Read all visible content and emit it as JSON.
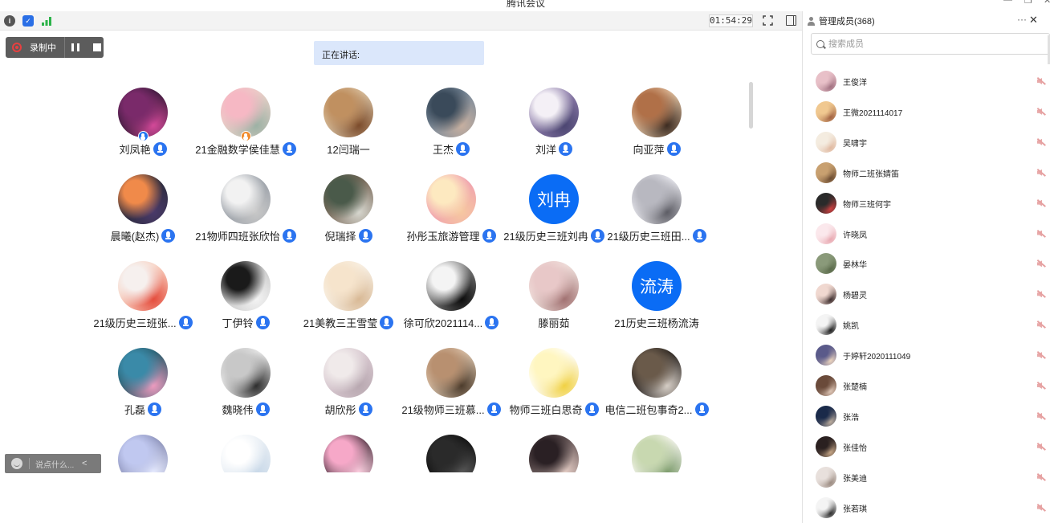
{
  "window": {
    "title": "腾讯会议"
  },
  "toolbar": {
    "timer": "01:54:29"
  },
  "recording": {
    "label": "录制中"
  },
  "speaking": {
    "label": "正在讲话:"
  },
  "chat": {
    "placeholder": "说点什么...",
    "chevron": "<"
  },
  "colors": {
    "accent": "#0a6cf5",
    "speaking_bg": "#dbe7fb",
    "rec_bar": "#5c5c5c"
  },
  "participants": [
    {
      "name": "刘凤艳",
      "avatar": "photo",
      "colors": [
        "#7a2a6a",
        "#d64a9a",
        "#3a1a3a"
      ],
      "mic": true,
      "badge": "host"
    },
    {
      "name": "21金融数学侯佳慧",
      "avatar": "photo",
      "colors": [
        "#f6b8c4",
        "#9bb1a4",
        "#e8d0c8"
      ],
      "mic": true,
      "badge": "cohost"
    },
    {
      "name": "12闫瑞一",
      "avatar": "photo",
      "colors": [
        "#c09060",
        "#7a4a2a",
        "#d8c0a0"
      ],
      "mic": false
    },
    {
      "name": "王杰",
      "avatar": "photo",
      "colors": [
        "#3a4a5a",
        "#c8b0a0",
        "#7a8a9a"
      ],
      "mic": true
    },
    {
      "name": "刘洋",
      "avatar": "photo",
      "colors": [
        "#f4f0f6",
        "#4a4470",
        "#8a7aa8"
      ],
      "mic": true
    },
    {
      "name": "向亚萍",
      "avatar": "photo",
      "colors": [
        "#b07048",
        "#3a2a20",
        "#e0c0a0"
      ],
      "mic": true
    },
    {
      "name": "晨曦(赵杰)",
      "avatar": "photo",
      "colors": [
        "#f08a4a",
        "#4a3a6a",
        "#2a2a3a"
      ],
      "mic": true
    },
    {
      "name": "21物师四班张欣怡",
      "avatar": "photo",
      "colors": [
        "#f2f2f2",
        "#c8c8c8",
        "#9aa0a8"
      ],
      "mic": true
    },
    {
      "name": "倪瑞择",
      "avatar": "photo",
      "colors": [
        "#4a5a4a",
        "#d8d8d0",
        "#7a6a5a"
      ],
      "mic": true
    },
    {
      "name": "孙彤玉旅游管理",
      "avatar": "photo",
      "colors": [
        "#fde9c0",
        "#f6c8a0",
        "#f0a0b0"
      ],
      "mic": true
    },
    {
      "name": "21级历史三班刘冉",
      "avatar": "text",
      "text": "刘冉",
      "mic": true
    },
    {
      "name": "21级历史三班田...",
      "avatar": "photo",
      "colors": [
        "#b8b8c0",
        "#5a5a62",
        "#e8e8ee"
      ],
      "mic": true
    },
    {
      "name": "21级历史三班张...",
      "avatar": "photo",
      "colors": [
        "#f6f0ee",
        "#e44a3a",
        "#f8d0c0"
      ],
      "mic": true
    },
    {
      "name": "丁伊铃",
      "avatar": "photo",
      "colors": [
        "#1a1a1a",
        "#f4f4f4",
        "#c8c8c8"
      ],
      "mic": true
    },
    {
      "name": "21美教三王雪莹",
      "avatar": "photo",
      "colors": [
        "#f6e4cc",
        "#d8b894",
        "#f8f0e4"
      ],
      "mic": true
    },
    {
      "name": "徐可欣2021114...",
      "avatar": "photo",
      "colors": [
        "#f4f4f4",
        "#0a0a0a",
        "#7a7a7a"
      ],
      "mic": true
    },
    {
      "name": "滕丽茹",
      "avatar": "photo",
      "colors": [
        "#e8c8c8",
        "#a07070",
        "#f0e0dc"
      ],
      "mic": false
    },
    {
      "name": "21历史三班杨流涛",
      "avatar": "text",
      "text": "流涛",
      "mic": false
    },
    {
      "name": "孔磊",
      "avatar": "photo",
      "colors": [
        "#3a8aa8",
        "#f09cc0",
        "#2a5a6a"
      ],
      "mic": true
    },
    {
      "name": "魏晓伟",
      "avatar": "photo",
      "colors": [
        "#c8c8c8",
        "#2a2a2a",
        "#e8e8e8"
      ],
      "mic": true
    },
    {
      "name": "胡欣彤",
      "avatar": "photo",
      "colors": [
        "#f0eaea",
        "#b8a8b0",
        "#d8c8d0"
      ],
      "mic": true
    },
    {
      "name": "21级物师三班慕...",
      "avatar": "photo",
      "colors": [
        "#b89070",
        "#4a3a2a",
        "#d8c0a8"
      ],
      "mic": true
    },
    {
      "name": "物师三班白思奇",
      "avatar": "photo",
      "colors": [
        "#fff6c0",
        "#f0d040",
        "#ffffff"
      ],
      "mic": true
    },
    {
      "name": "电信二班包事奇2...",
      "avatar": "photo",
      "colors": [
        "#6a5a4a",
        "#d8d0c8",
        "#2a2420"
      ],
      "mic": true
    },
    {
      "name": "",
      "avatar": "photo",
      "colors": [
        "#c0c8f0",
        "#e8ecff",
        "#8a90b8"
      ],
      "mic": false
    },
    {
      "name": "",
      "avatar": "photo",
      "colors": [
        "#ffffff",
        "#c8d8e8",
        "#e8eef4"
      ],
      "mic": false
    },
    {
      "name": "",
      "avatar": "photo",
      "colors": [
        "#f6a8c8",
        "#fbd0e0",
        "#5a3a4a"
      ],
      "mic": false
    },
    {
      "name": "",
      "avatar": "photo",
      "colors": [
        "#2a2a2a",
        "#5a5a5a",
        "#101010"
      ],
      "mic": false
    },
    {
      "name": "",
      "avatar": "photo",
      "colors": [
        "#2a2024",
        "#e8d0c8",
        "#6a5a5a"
      ],
      "mic": false
    },
    {
      "name": "",
      "avatar": "photo",
      "colors": [
        "#c8d8b0",
        "#7a9a6a",
        "#f4f4ec"
      ],
      "mic": false
    }
  ],
  "panel": {
    "title": "管理成员(368)",
    "more": "···",
    "close": "✕",
    "search_placeholder": "搜索成员",
    "members": [
      {
        "name": "王俊洋",
        "colors": [
          "#e8c0c8",
          "#a07080"
        ]
      },
      {
        "name": "王微2021114017",
        "colors": [
          "#f0c890",
          "#a06040"
        ]
      },
      {
        "name": "吴啸宇",
        "colors": [
          "#f4ece0",
          "#e0b8a0"
        ]
      },
      {
        "name": "物师二班张婧笛",
        "colors": [
          "#c8a070",
          "#6a4a30"
        ]
      },
      {
        "name": "物师三班何宇",
        "colors": [
          "#2a2a2a",
          "#d04040"
        ]
      },
      {
        "name": "许晓凤",
        "colors": [
          "#fbe8ec",
          "#e8a8b0"
        ]
      },
      {
        "name": "晏林华",
        "colors": [
          "#8a9a7a",
          "#5a6a4a"
        ]
      },
      {
        "name": "杨碧灵",
        "colors": [
          "#f0d8d0",
          "#3a2a2a"
        ]
      },
      {
        "name": "姚凯",
        "colors": [
          "#f4f4f4",
          "#1a1a1a"
        ]
      },
      {
        "name": "于婷轩2020111049",
        "colors": [
          "#5a5a8a",
          "#f0d8c0"
        ]
      },
      {
        "name": "张楚楠",
        "colors": [
          "#6a4a3a",
          "#e0c8b8"
        ]
      },
      {
        "name": "张浩",
        "colors": [
          "#1a2a4a",
          "#c0b0a0"
        ]
      },
      {
        "name": "张佳怡",
        "colors": [
          "#2a2020",
          "#c8a888"
        ]
      },
      {
        "name": "张美迪",
        "colors": [
          "#e8e0dc",
          "#9a8a80"
        ]
      },
      {
        "name": "张若琪",
        "colors": [
          "#f4f4f4",
          "#2a2a2a"
        ]
      }
    ]
  }
}
